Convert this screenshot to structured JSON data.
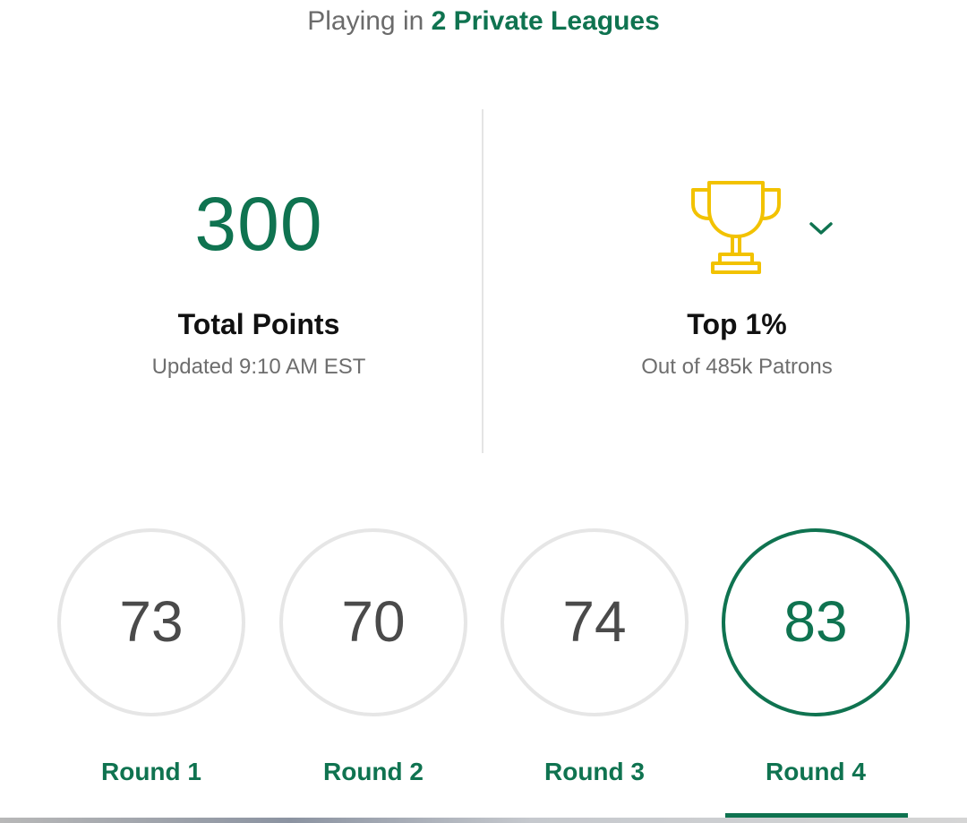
{
  "header": {
    "prefix": "Playing in ",
    "league_link": "2 Private Leagues"
  },
  "stats": {
    "total_points": {
      "value": "300",
      "label": "Total Points",
      "updated": "Updated 9:10 AM EST"
    },
    "rank": {
      "label": "Top 1%",
      "subtitle": "Out of 485k Patrons",
      "icon": "trophy-icon",
      "toggle_icon": "chevron-down-icon"
    }
  },
  "rounds": [
    {
      "score": "73",
      "label": "Round 1",
      "active": false
    },
    {
      "score": "70",
      "label": "Round 2",
      "active": false
    },
    {
      "score": "74",
      "label": "Round 3",
      "active": false
    },
    {
      "score": "83",
      "label": "Round 4",
      "active": true
    }
  ],
  "colors": {
    "accent": "#0f7350",
    "trophy": "#f2c200",
    "inactive_ring": "#e6e6e6",
    "muted_text": "#6e6e6e"
  }
}
